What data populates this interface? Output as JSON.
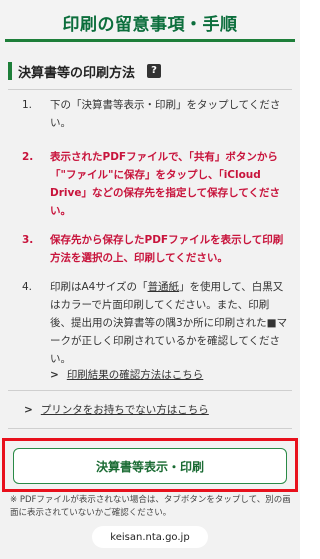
{
  "header": {
    "title": "印刷の留意事項・手順"
  },
  "section": {
    "title": "決算書等の印刷方法",
    "help_icon": "?"
  },
  "steps": [
    {
      "num": "1.",
      "text": "下の「決算書等表示・印刷」をタップしてください。"
    },
    {
      "num": "2.",
      "text": "表示されたPDFファイルで、「共有」ボタンから「\"ファイル\"に保存」をタップし、「iCloud Drive」などの保存先を指定して保存してください。"
    },
    {
      "num": "3.",
      "text": "保存先から保存したPDFファイルを表示して印刷方法を選択の上、印刷してください。"
    },
    {
      "num": "4.",
      "text_before": "印刷はA4サイズの「",
      "text_link": "普通紙",
      "text_after": "」を使用して、白黒又はカラーで片面印刷してください。また、印刷後、提出用の決算書等の隅3か所に印刷された■マークが正しく印刷されているかを確認してください。"
    }
  ],
  "links": {
    "print_result": "印刷結果の確認方法はこちら",
    "no_printer": "プリンタをお持ちでない方はこちら"
  },
  "action_button": {
    "label": "決算書等表示・印刷"
  },
  "note": "※ PDFファイルが表示されない場合は、タブボタンをタップして、別の画面に表示されていないかご確認ください。",
  "url": "keisan.nta.go.jp"
}
